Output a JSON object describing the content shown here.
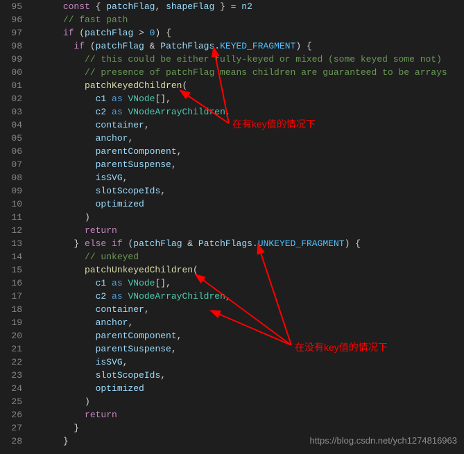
{
  "lineStart": 95,
  "lineEnd": 128,
  "code": {
    "tokens": [
      [
        [
          "kw",
          "const"
        ],
        [
          "punct",
          " { "
        ],
        [
          "var",
          "patchFlag"
        ],
        [
          "punct",
          ", "
        ],
        [
          "var",
          "shapeFlag"
        ],
        [
          "punct",
          " } = "
        ],
        [
          "var",
          "n2"
        ]
      ],
      [
        [
          "comment",
          "// fast path"
        ]
      ],
      [
        [
          "kw",
          "if"
        ],
        [
          "punct",
          " ("
        ],
        [
          "var",
          "patchFlag"
        ],
        [
          "punct",
          " > "
        ],
        [
          "const",
          "0"
        ],
        [
          "punct",
          ") {"
        ]
      ],
      [
        [
          "kw",
          "if"
        ],
        [
          "punct",
          " ("
        ],
        [
          "var",
          "patchFlag"
        ],
        [
          "punct",
          " & "
        ],
        [
          "var",
          "PatchFlags"
        ],
        [
          "punct",
          "."
        ],
        [
          "const",
          "KEYED_FRAGMENT"
        ],
        [
          "punct",
          ") {"
        ]
      ],
      [
        [
          "comment",
          "// this could be either fully-keyed or mixed (some keyed some not)"
        ]
      ],
      [
        [
          "comment",
          "// presence of patchFlag means children are guaranteed to be arrays"
        ]
      ],
      [
        [
          "fn",
          "patchKeyedChildren"
        ],
        [
          "punct",
          "("
        ]
      ],
      [
        [
          "var",
          "c1"
        ],
        [
          "punct",
          " "
        ],
        [
          "kw2",
          "as"
        ],
        [
          "punct",
          " "
        ],
        [
          "type",
          "VNode"
        ],
        [
          "punct",
          "[],"
        ]
      ],
      [
        [
          "var",
          "c2"
        ],
        [
          "punct",
          " "
        ],
        [
          "kw2",
          "as"
        ],
        [
          "punct",
          " "
        ],
        [
          "type",
          "VNodeArrayChildren"
        ],
        [
          "punct",
          ","
        ]
      ],
      [
        [
          "var",
          "container"
        ],
        [
          "punct",
          ","
        ]
      ],
      [
        [
          "var",
          "anchor"
        ],
        [
          "punct",
          ","
        ]
      ],
      [
        [
          "var",
          "parentComponent"
        ],
        [
          "punct",
          ","
        ]
      ],
      [
        [
          "var",
          "parentSuspense"
        ],
        [
          "punct",
          ","
        ]
      ],
      [
        [
          "var",
          "isSVG"
        ],
        [
          "punct",
          ","
        ]
      ],
      [
        [
          "var",
          "slotScopeIds"
        ],
        [
          "punct",
          ","
        ]
      ],
      [
        [
          "var",
          "optimized"
        ]
      ],
      [
        [
          "punct",
          ")"
        ]
      ],
      [
        [
          "kw",
          "return"
        ]
      ],
      [
        [
          "punct",
          "} "
        ],
        [
          "kw",
          "else"
        ],
        [
          "punct",
          " "
        ],
        [
          "kw",
          "if"
        ],
        [
          "punct",
          " ("
        ],
        [
          "var",
          "patchFlag"
        ],
        [
          "punct",
          " & "
        ],
        [
          "var",
          "PatchFlags"
        ],
        [
          "punct",
          "."
        ],
        [
          "const",
          "UNKEYED_FRAGMENT"
        ],
        [
          "punct",
          ") {"
        ]
      ],
      [
        [
          "comment",
          "// unkeyed"
        ]
      ],
      [
        [
          "fn",
          "patchUnkeyedChildren"
        ],
        [
          "punct",
          "("
        ]
      ],
      [
        [
          "var",
          "c1"
        ],
        [
          "punct",
          " "
        ],
        [
          "kw2",
          "as"
        ],
        [
          "punct",
          " "
        ],
        [
          "type",
          "VNode"
        ],
        [
          "punct",
          "[],"
        ]
      ],
      [
        [
          "var",
          "c2"
        ],
        [
          "punct",
          " "
        ],
        [
          "kw2",
          "as"
        ],
        [
          "punct",
          " "
        ],
        [
          "type",
          "VNodeArrayChildren"
        ],
        [
          "punct",
          ","
        ]
      ],
      [
        [
          "var",
          "container"
        ],
        [
          "punct",
          ","
        ]
      ],
      [
        [
          "var",
          "anchor"
        ],
        [
          "punct",
          ","
        ]
      ],
      [
        [
          "var",
          "parentComponent"
        ],
        [
          "punct",
          ","
        ]
      ],
      [
        [
          "var",
          "parentSuspense"
        ],
        [
          "punct",
          ","
        ]
      ],
      [
        [
          "var",
          "isSVG"
        ],
        [
          "punct",
          ","
        ]
      ],
      [
        [
          "var",
          "slotScopeIds"
        ],
        [
          "punct",
          ","
        ]
      ],
      [
        [
          "var",
          "optimized"
        ]
      ],
      [
        [
          "punct",
          ")"
        ]
      ],
      [
        [
          "kw",
          "return"
        ]
      ],
      [
        [
          "punct",
          "}"
        ]
      ],
      [
        [
          "punct",
          "}"
        ]
      ]
    ],
    "indents": [
      3,
      3,
      3,
      4,
      5,
      5,
      5,
      6,
      6,
      6,
      6,
      6,
      6,
      6,
      6,
      6,
      5,
      5,
      4,
      5,
      5,
      6,
      6,
      6,
      6,
      6,
      6,
      6,
      6,
      6,
      5,
      5,
      4,
      3
    ]
  },
  "annotations": {
    "a1": "在有key值的情况下",
    "a2": "在没有key值的情况下"
  },
  "watermark": "https://blog.csdn.net/ych1274816963"
}
